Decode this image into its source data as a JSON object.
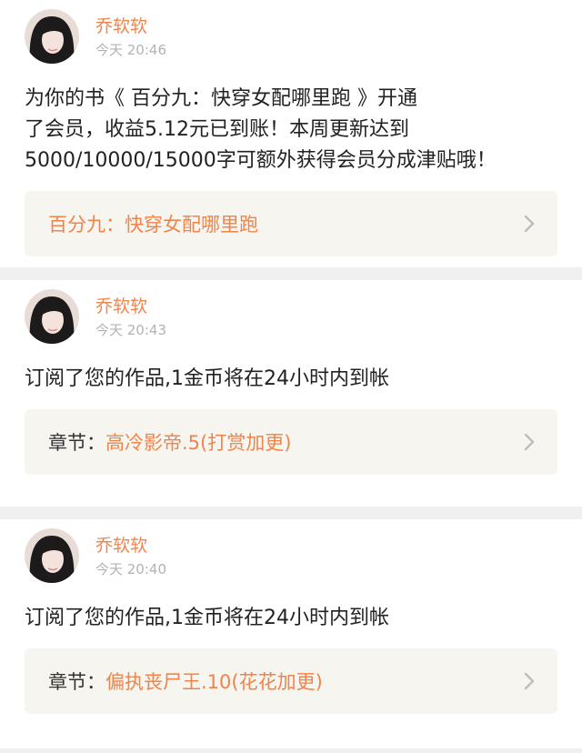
{
  "notifications": [
    {
      "username": "乔软软",
      "time": "今天 20:46",
      "message": "为你的书《 百分九：快穿女配哪里跑 》开通\n了会员，收益5.12元已到账！本周更新达到\n5000/10000/15000字可额外获得会员分成津贴哦！",
      "link_prefix": "",
      "link_title": "百分九：快穿女配哪里跑"
    },
    {
      "username": "乔软软",
      "time": "今天 20:43",
      "message": "订阅了您的作品,1金币将在24小时内到帐",
      "link_prefix": "章节：",
      "link_title": "高冷影帝.5(打赏加更)"
    },
    {
      "username": "乔软软",
      "time": "今天 20:40",
      "message": "订阅了您的作品,1金币将在24小时内到帐",
      "link_prefix": "章节：",
      "link_title": "偏执丧尸王.10(花花加更)"
    }
  ],
  "icons": {
    "avatar": "user-avatar",
    "chevron": "chevron-right-icon"
  },
  "colors": {
    "accent": "#f0844a",
    "time": "#b3b3b3",
    "link_box_bg": "#f6f5f0",
    "page_bg": "#f0f0f0"
  }
}
